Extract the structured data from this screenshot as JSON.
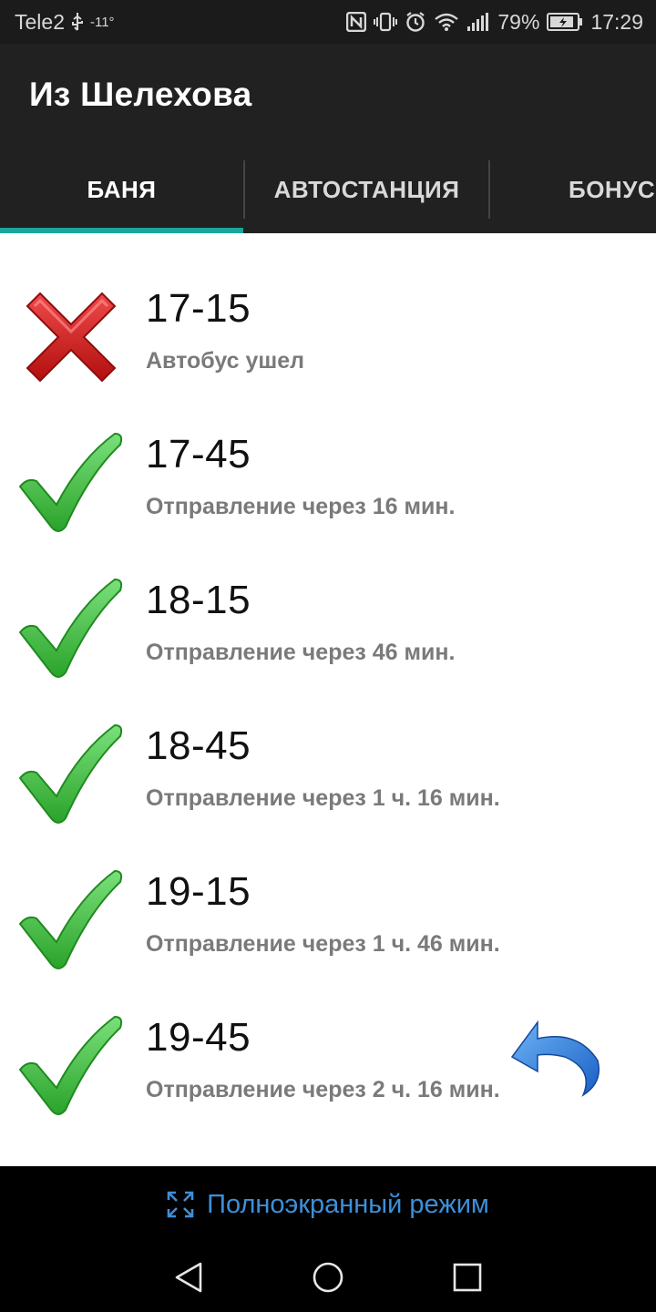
{
  "statusbar": {
    "carrier": "Tele2",
    "temperature": "-11°",
    "battery_percent": "79%",
    "time": "17:29"
  },
  "toolbar": {
    "title": "Из Шелехова"
  },
  "tabs": [
    {
      "label": "БАНЯ",
      "active": true
    },
    {
      "label": "АВТОСТАНЦИЯ",
      "active": false
    },
    {
      "label": "БОНУС",
      "active": false
    }
  ],
  "schedule": [
    {
      "time": "17-15",
      "status": "Автобус ушел",
      "state": "departed"
    },
    {
      "time": "17-45",
      "status": "Отправление через 16 мин.",
      "state": "upcoming"
    },
    {
      "time": "18-15",
      "status": "Отправление через 46 мин.",
      "state": "upcoming"
    },
    {
      "time": "18-45",
      "status": "Отправление через 1 ч. 16 мин.",
      "state": "upcoming"
    },
    {
      "time": "19-15",
      "status": "Отправление через 1 ч. 46 мин.",
      "state": "upcoming"
    },
    {
      "time": "19-45",
      "status": "Отправление через 2 ч. 16 мин.",
      "state": "upcoming"
    }
  ],
  "fullscreen": {
    "label": "Полноэкранный режим"
  },
  "icons": {
    "departed": "red-cross-icon",
    "upcoming": "green-check-icon",
    "undo": "undo-arrow-icon",
    "fullscreen": "expand-icon"
  },
  "colors": {
    "accent": "#1aa69a",
    "check_green": "#3cc23c",
    "cross_red": "#cc1a1a",
    "link_blue": "#3d8fd9"
  }
}
